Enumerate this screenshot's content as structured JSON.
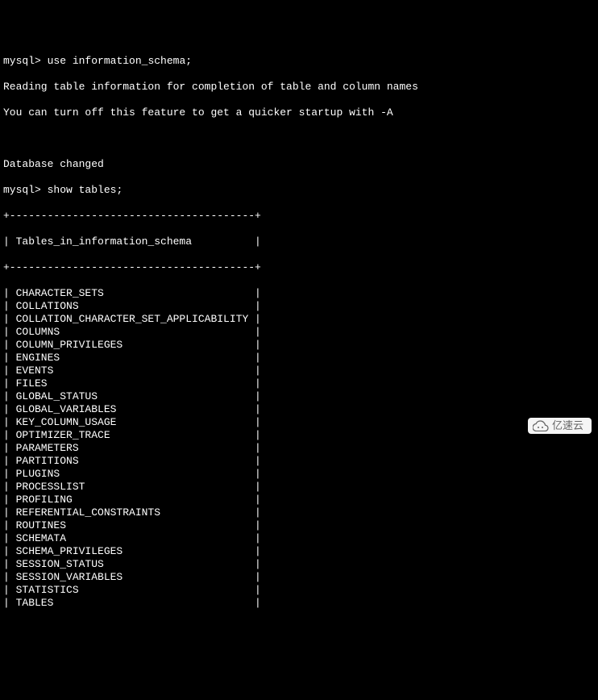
{
  "prompt": "mysql>",
  "commands": {
    "use_db": "use information_schema;",
    "show_tables": "show tables;"
  },
  "messages": {
    "reading": "Reading table information for completion of table and column names",
    "turnoff": "You can turn off this feature to get a quicker startup with -A",
    "changed": "Database changed"
  },
  "table": {
    "border": "+---------------------------------------+",
    "header": "Tables_in_information_schema",
    "rows": [
      "CHARACTER_SETS",
      "COLLATIONS",
      "COLLATION_CHARACTER_SET_APPLICABILITY",
      "COLUMNS",
      "COLUMN_PRIVILEGES",
      "ENGINES",
      "EVENTS",
      "FILES",
      "GLOBAL_STATUS",
      "GLOBAL_VARIABLES",
      "KEY_COLUMN_USAGE",
      "OPTIMIZER_TRACE",
      "PARAMETERS",
      "PARTITIONS",
      "PLUGINS",
      "PROCESSLIST",
      "PROFILING",
      "REFERENTIAL_CONSTRAINTS",
      "ROUTINES",
      "SCHEMATA",
      "SCHEMA_PRIVILEGES",
      "SESSION_STATUS",
      "SESSION_VARIABLES",
      "STATISTICS",
      "TABLES"
    ]
  },
  "watermark": "亿速云"
}
